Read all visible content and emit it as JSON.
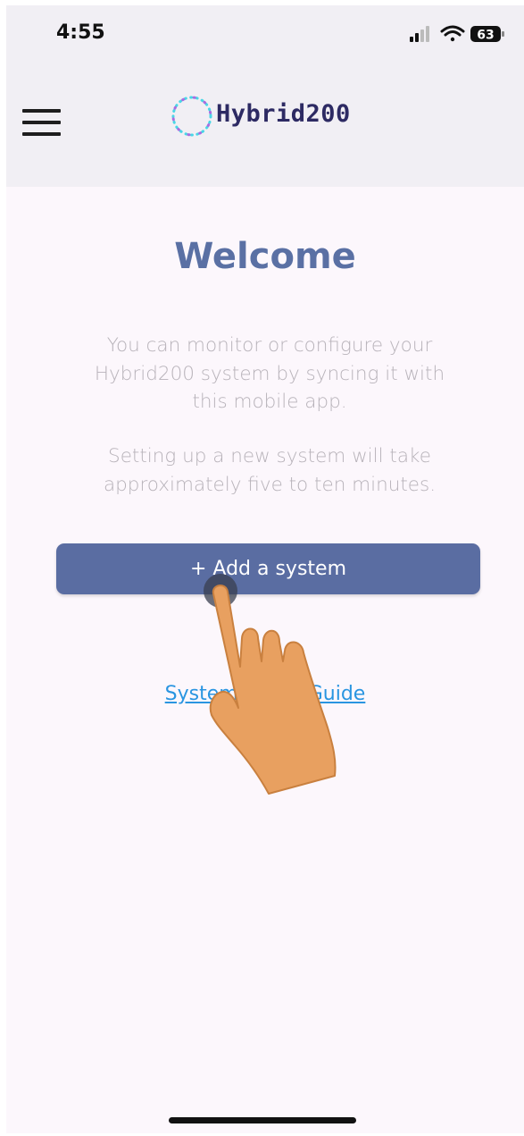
{
  "status_bar": {
    "time": "4:55",
    "battery": "63"
  },
  "header": {
    "app_name": "Hybrid200",
    "menu_icon": "hamburger-menu-icon",
    "background": "#f1eff4"
  },
  "main": {
    "title": "Welcome",
    "paragraph_1": "You can monitor or configure your Hybrid200 system by syncing it with this mobile app.",
    "paragraph_2": "Setting up a new system will take approximately five to ten minutes.",
    "add_button_label": "+ Add a system",
    "guide_link_label": "System Setup Guide"
  },
  "colors": {
    "accent": "#5a6da2",
    "title": "#5a70a4",
    "link": "#2a95e1",
    "logo_text": "#2d2a63",
    "body_text": "#b8b3ba"
  }
}
